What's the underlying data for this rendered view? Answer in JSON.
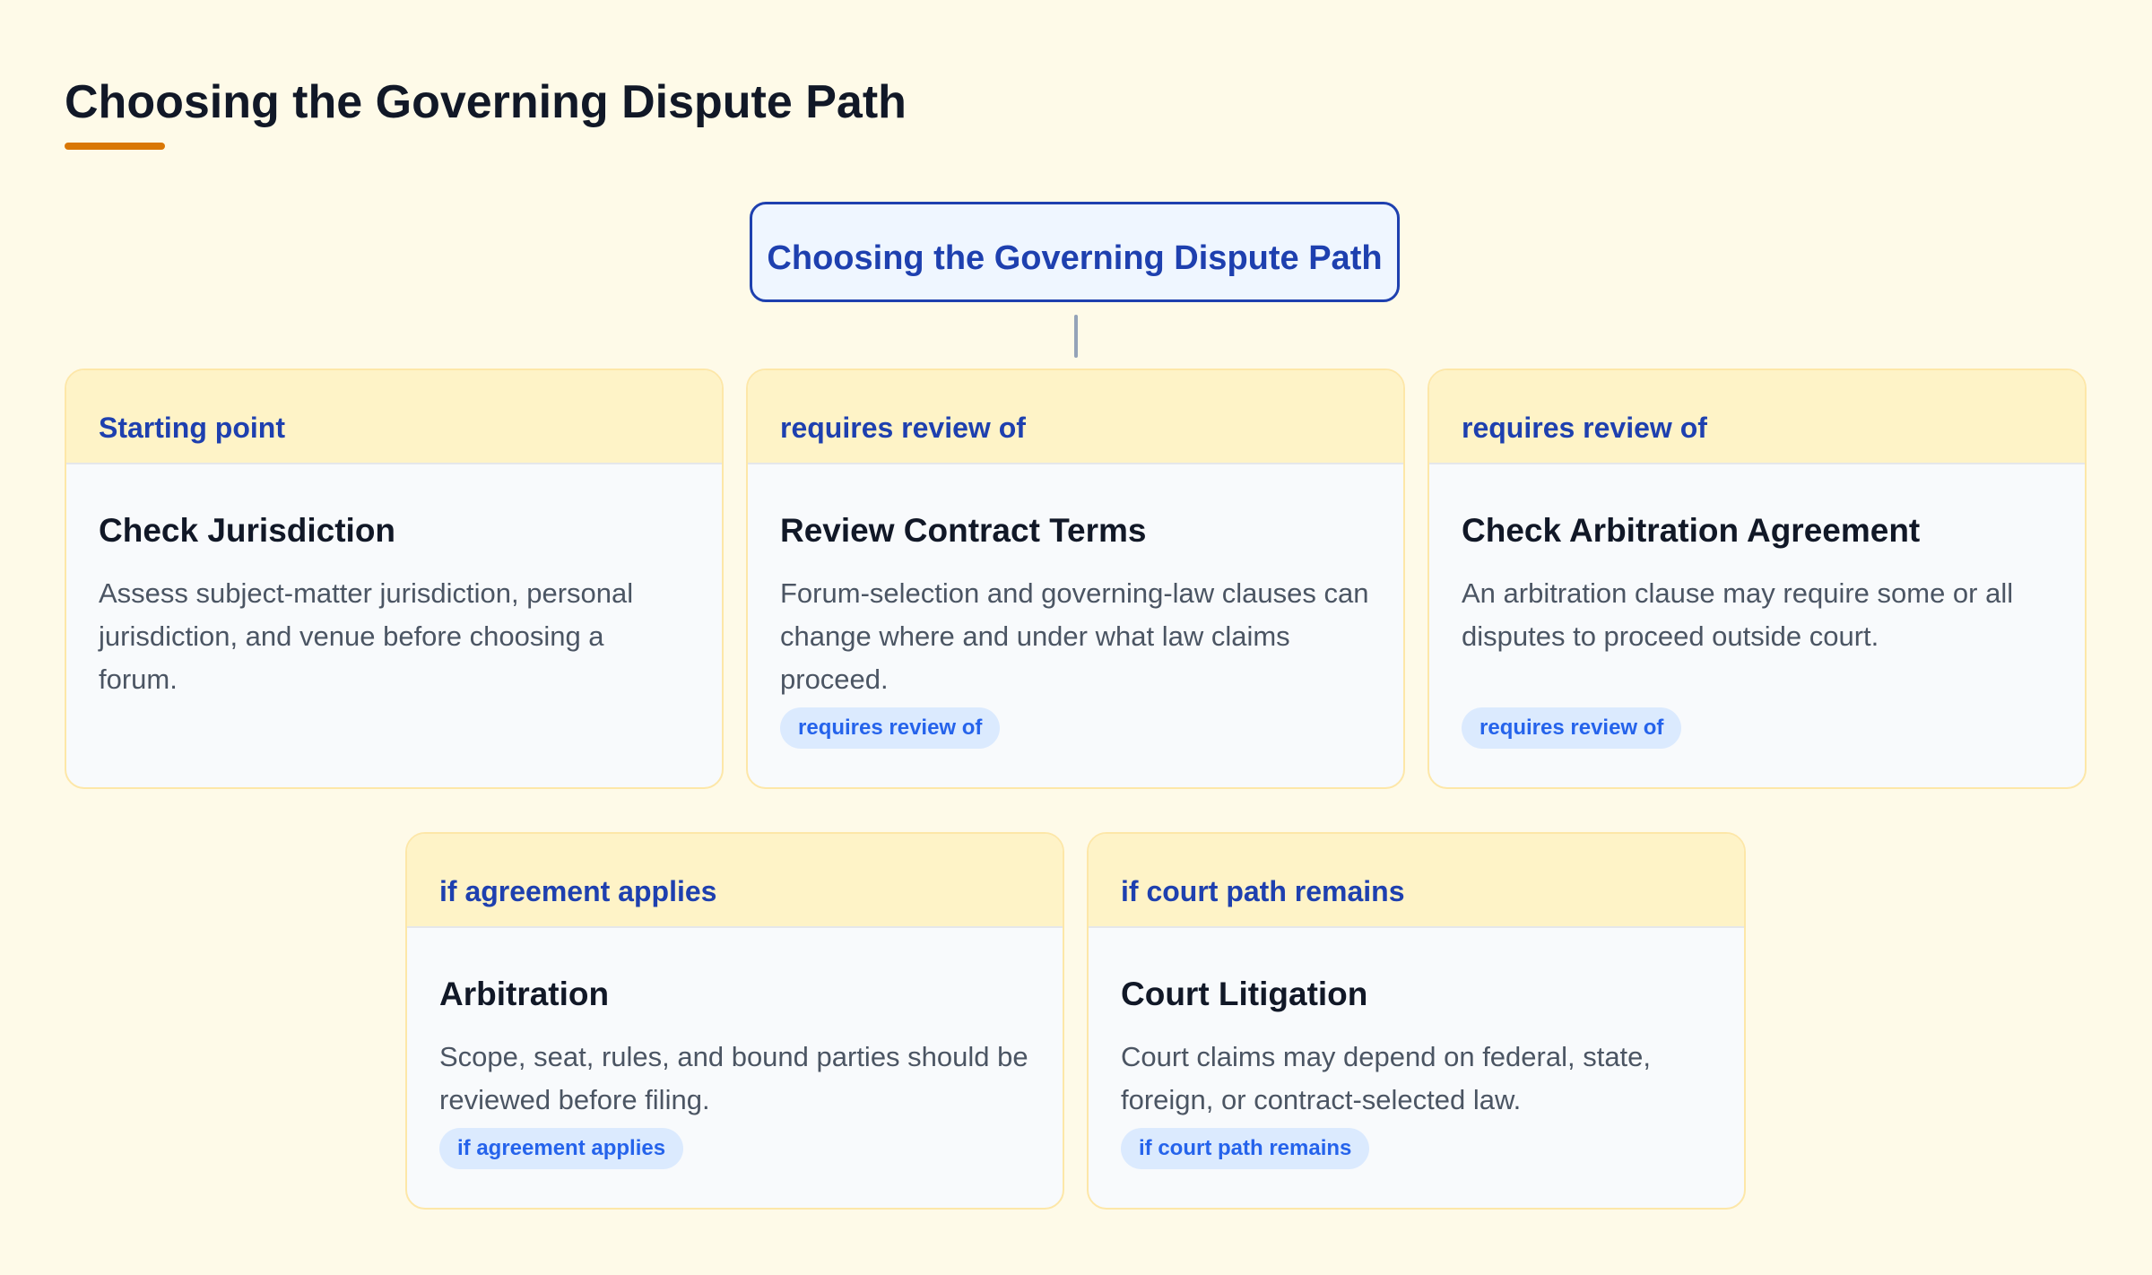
{
  "page": {
    "title": "Choosing the Governing Dispute Path"
  },
  "colors": {
    "accent_underline": "#d97706",
    "root_border": "#1e40af",
    "root_fill": "#eff6ff",
    "card_header_fill": "#fef3c7",
    "badge_fill": "#dbeafe",
    "badge_text": "#2563eb",
    "background": "#fefae8"
  },
  "diagram": {
    "root": {
      "label": "Choosing the Governing Dispute Path"
    },
    "nodes": [
      {
        "tag": "Starting point",
        "title": "Check Jurisdiction",
        "description": "Assess subject-matter jurisdiction, personal jurisdiction, and venue before choosing a forum.",
        "badge": ""
      },
      {
        "tag": "requires review of",
        "title": "Review Contract Terms",
        "description": "Forum-selection and governing-law clauses can change where and under what law claims proceed.",
        "badge": "requires review of"
      },
      {
        "tag": "requires review of",
        "title": "Check Arbitration Agreement",
        "description": "An arbitration clause may require some or all disputes to proceed outside court.",
        "badge": "requires review of"
      },
      {
        "tag": "if agreement applies",
        "title": "Arbitration",
        "description": "Scope, seat, rules, and bound parties should be reviewed before filing.",
        "badge": "if agreement applies"
      },
      {
        "tag": "if court path remains",
        "title": "Court Litigation",
        "description": "Court claims may depend on federal, state, foreign, or contract-selected law.",
        "badge": "if court path remains"
      }
    ]
  }
}
